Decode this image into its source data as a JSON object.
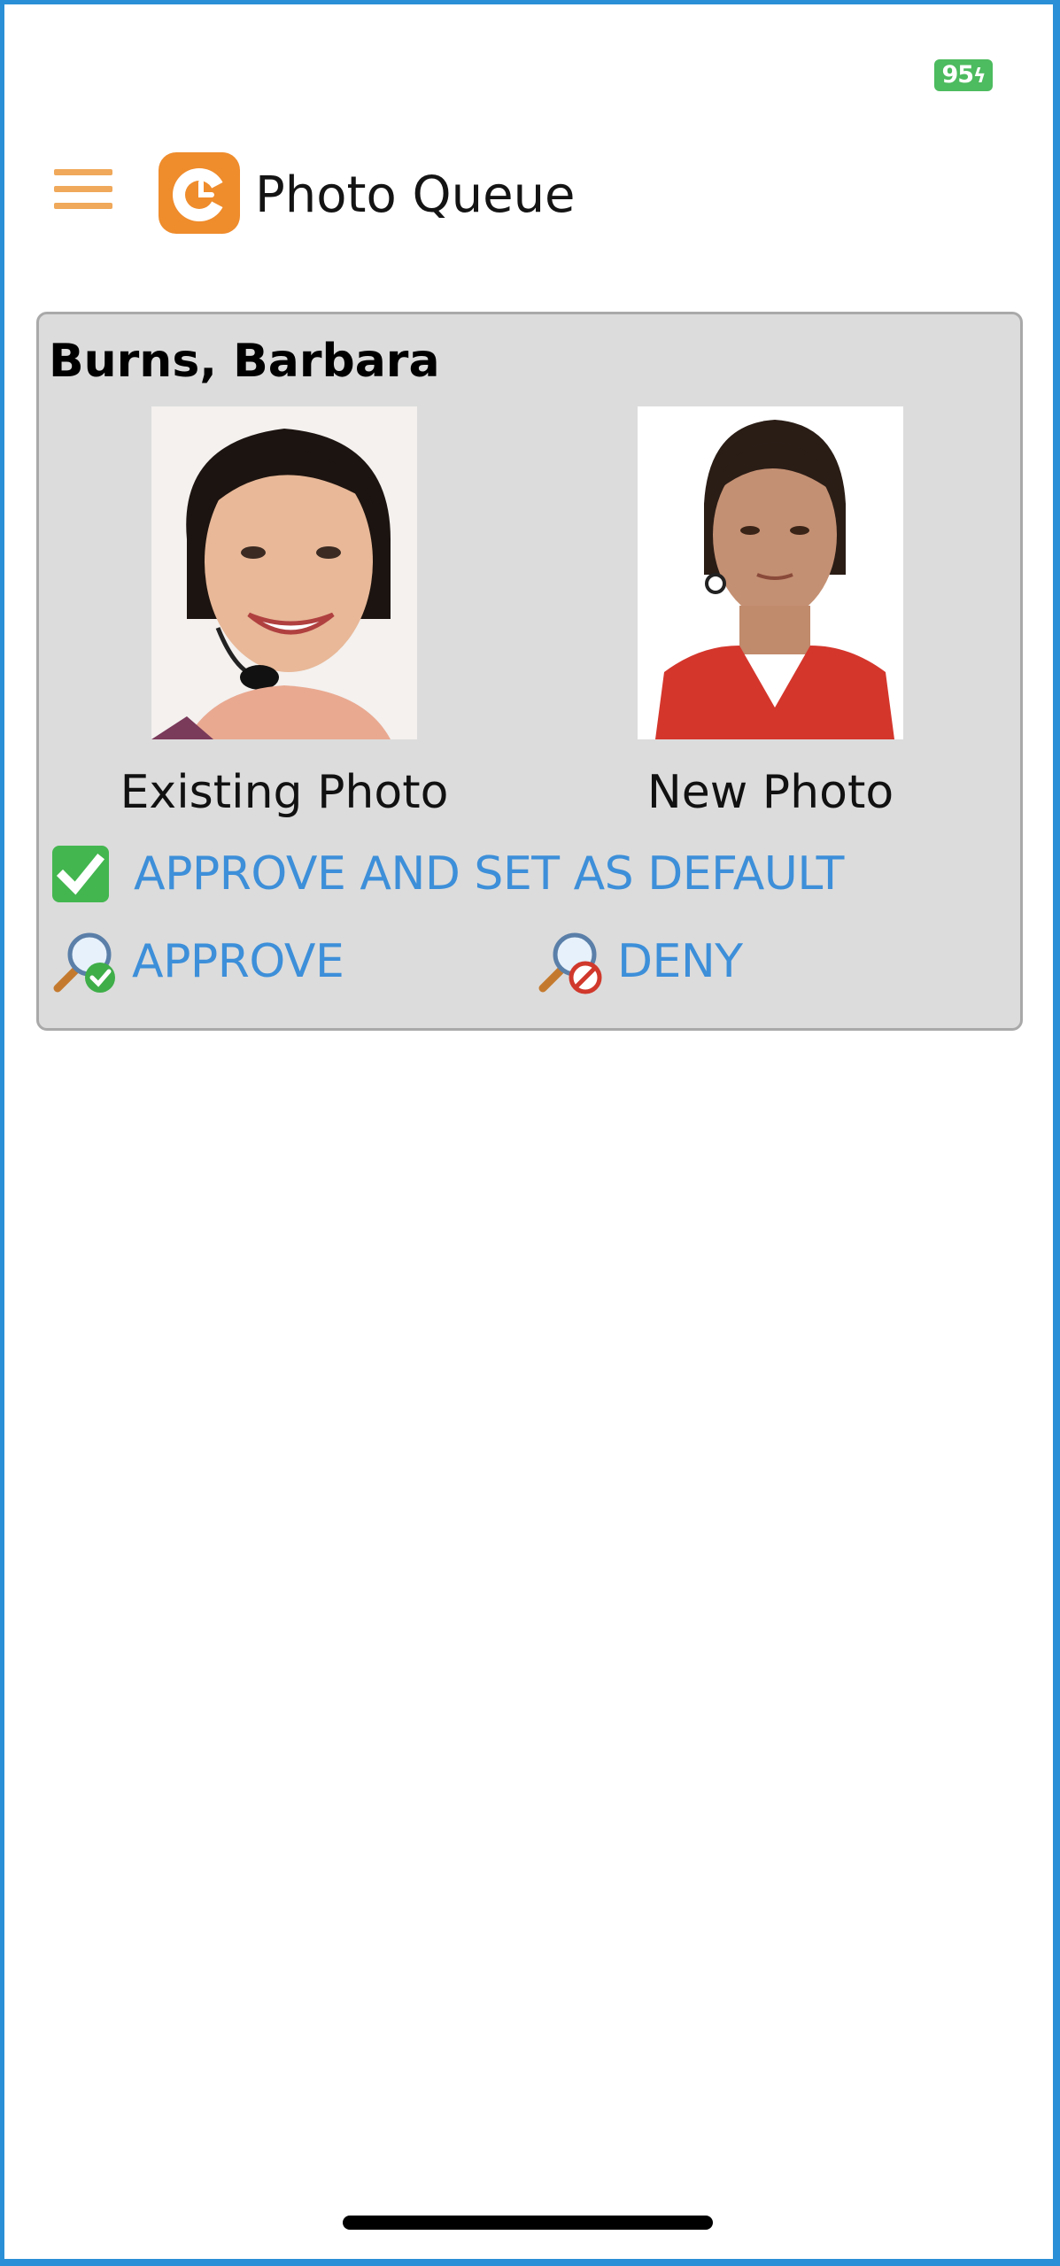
{
  "status_bar": {
    "battery_level": "95"
  },
  "header": {
    "menu_icon": "hamburger-menu-icon",
    "logo_icon": "app-logo-icon",
    "title": "Photo Queue"
  },
  "queue_item": {
    "person_name": "Burns, Barbara",
    "existing_photo_caption": "Existing Photo",
    "new_photo_caption": "New Photo",
    "actions": {
      "approve_default_label": "APPROVE AND SET AS DEFAULT",
      "approve_default_icon": "green-checkbox-icon",
      "approve_label": "APPROVE",
      "approve_icon": "magnifier-approve-icon",
      "deny_label": "DENY",
      "deny_icon": "magnifier-deny-icon"
    }
  },
  "colors": {
    "frame_border": "#2a8fd6",
    "accent_orange": "#ef8c2c",
    "action_link_blue": "#3d8fd9",
    "card_background": "#dcdcdc",
    "battery_green": "#4dbb5f"
  }
}
